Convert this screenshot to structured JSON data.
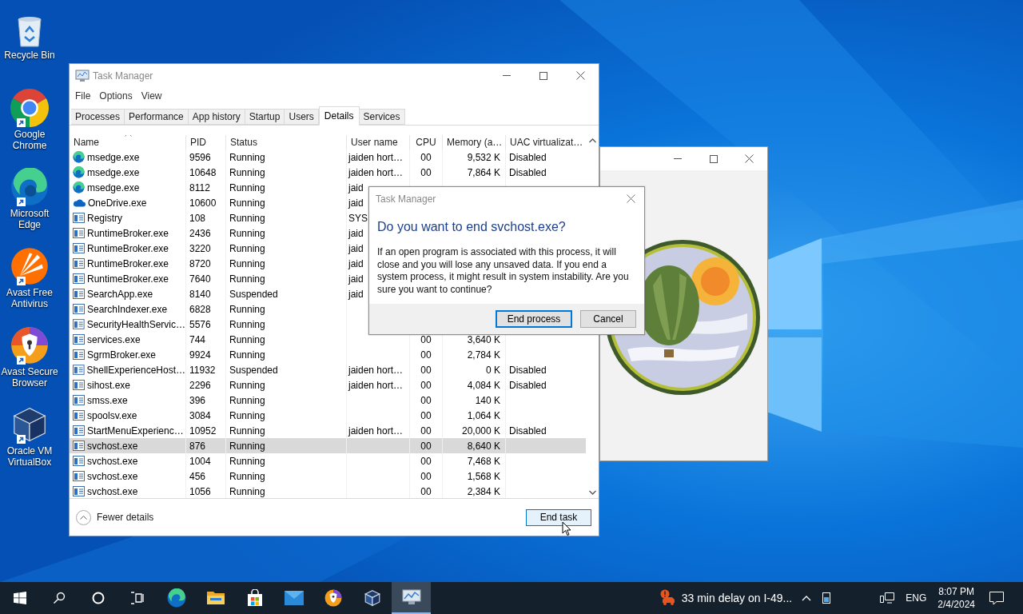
{
  "desktop": {
    "icons": [
      {
        "kind": "bin",
        "label": "Recycle Bin",
        "shortcut": false
      },
      {
        "kind": "chrome",
        "label": "Google Chrome",
        "shortcut": true
      },
      {
        "kind": "edge",
        "label": "Microsoft Edge",
        "shortcut": true
      },
      {
        "kind": "avast",
        "label": "Avast Free Antivirus",
        "shortcut": true
      },
      {
        "kind": "browser",
        "label": "Avast Secure Browser",
        "shortcut": true
      },
      {
        "kind": "virtualbox",
        "label": "Oracle VM VirtualBox",
        "shortcut": true
      }
    ]
  },
  "task_manager": {
    "title": "Task Manager",
    "menu": [
      "File",
      "Options",
      "View"
    ],
    "tabs": [
      {
        "label": "Processes",
        "selected": false
      },
      {
        "label": "Performance",
        "selected": false
      },
      {
        "label": "App history",
        "selected": false
      },
      {
        "label": "Startup",
        "selected": false
      },
      {
        "label": "Users",
        "selected": false
      },
      {
        "label": "Details",
        "selected": true
      },
      {
        "label": "Services",
        "selected": false
      }
    ],
    "columns": [
      {
        "label": "Name",
        "sorted": true
      },
      {
        "label": "PID",
        "sorted": false
      },
      {
        "label": "Status",
        "sorted": false
      },
      {
        "label": "User name",
        "sorted": false
      },
      {
        "label": "CPU",
        "sorted": false
      },
      {
        "label": "Memory (a…",
        "sorted": false
      },
      {
        "label": "UAC virtualizat…",
        "sorted": false
      }
    ],
    "rows": [
      {
        "kind": "edge",
        "name": "msedge.exe",
        "pid": "9596",
        "status": "Running",
        "user": "jaiden hort…",
        "cpu": "00",
        "memory": "9,532 K",
        "uac": "Disabled",
        "selected": false
      },
      {
        "kind": "edge",
        "name": "msedge.exe",
        "pid": "10648",
        "status": "Running",
        "user": "jaiden hort…",
        "cpu": "00",
        "memory": "7,864 K",
        "uac": "Disabled",
        "selected": false
      },
      {
        "kind": "edge",
        "name": "msedge.exe",
        "pid": "8112",
        "status": "Running",
        "user": "jaid",
        "selected": false
      },
      {
        "kind": "onedrive",
        "name": "OneDrive.exe",
        "pid": "10600",
        "status": "Running",
        "user": "jaid",
        "selected": false
      },
      {
        "kind": "app",
        "name": "Registry",
        "pid": "108",
        "status": "Running",
        "user": "SYS",
        "selected": false
      },
      {
        "kind": "app",
        "name": "RuntimeBroker.exe",
        "pid": "2436",
        "status": "Running",
        "user": "jaid",
        "selected": false
      },
      {
        "kind": "app",
        "name": "RuntimeBroker.exe",
        "pid": "3220",
        "status": "Running",
        "user": "jaid",
        "selected": false
      },
      {
        "kind": "app",
        "name": "RuntimeBroker.exe",
        "pid": "8720",
        "status": "Running",
        "user": "jaid",
        "selected": false
      },
      {
        "kind": "app",
        "name": "RuntimeBroker.exe",
        "pid": "7640",
        "status": "Running",
        "user": "jaid",
        "selected": false
      },
      {
        "kind": "app",
        "name": "SearchApp.exe",
        "pid": "8140",
        "status": "Suspended",
        "user": "jaid",
        "selected": false
      },
      {
        "kind": "app",
        "name": "SearchIndexer.exe",
        "pid": "6828",
        "status": "Running",
        "selected": false
      },
      {
        "kind": "app",
        "name": "SecurityHealthServic…",
        "pid": "5576",
        "status": "Running",
        "selected": false
      },
      {
        "kind": "app",
        "name": "services.exe",
        "pid": "744",
        "status": "Running",
        "cpu": "00",
        "memory": "3,640 K",
        "selected": false
      },
      {
        "kind": "app",
        "name": "SgrmBroker.exe",
        "pid": "9924",
        "status": "Running",
        "cpu": "00",
        "memory": "2,784 K",
        "selected": false
      },
      {
        "kind": "app",
        "name": "ShellExperienceHost…",
        "pid": "11932",
        "status": "Suspended",
        "user": "jaiden hort…",
        "cpu": "00",
        "memory": "0 K",
        "uac": "Disabled",
        "selected": false
      },
      {
        "kind": "app",
        "name": "sihost.exe",
        "pid": "2296",
        "status": "Running",
        "user": "jaiden hort…",
        "cpu": "00",
        "memory": "4,084 K",
        "uac": "Disabled",
        "selected": false
      },
      {
        "kind": "app",
        "name": "smss.exe",
        "pid": "396",
        "status": "Running",
        "cpu": "00",
        "memory": "140 K",
        "selected": false
      },
      {
        "kind": "app",
        "name": "spoolsv.exe",
        "pid": "3084",
        "status": "Running",
        "cpu": "00",
        "memory": "1,064 K",
        "selected": false
      },
      {
        "kind": "app",
        "name": "StartMenuExperienc…",
        "pid": "10952",
        "status": "Running",
        "user": "jaiden hort…",
        "cpu": "00",
        "memory": "20,000 K",
        "uac": "Disabled",
        "selected": false
      },
      {
        "kind": "app",
        "name": "svchost.exe",
        "pid": "876",
        "status": "Running",
        "cpu": "00",
        "memory": "8,640 K",
        "selected": true
      },
      {
        "kind": "app",
        "name": "svchost.exe",
        "pid": "1004",
        "status": "Running",
        "cpu": "00",
        "memory": "7,468 K",
        "selected": false
      },
      {
        "kind": "app",
        "name": "svchost.exe",
        "pid": "456",
        "status": "Running",
        "cpu": "00",
        "memory": "1,568 K",
        "selected": false
      },
      {
        "kind": "app",
        "name": "svchost.exe",
        "pid": "1056",
        "status": "Running",
        "cpu": "00",
        "memory": "2,384 K",
        "selected": false
      }
    ],
    "fewer_details": "Fewer details",
    "end_task": "End task"
  },
  "dialog": {
    "title": "Task Manager",
    "heading": "Do you want to end svchost.exe?",
    "message": "If an open program is associated with this process, it will close and you will lose any unsaved data. If you end a system process, it might result in system instability. Are you sure you want to continue?",
    "buttons": [
      {
        "label": "End process",
        "default": true
      },
      {
        "label": "Cancel",
        "default": false
      }
    ]
  },
  "taskbar": {
    "items": [
      {
        "kind": "start",
        "active": false
      },
      {
        "kind": "search",
        "active": false
      },
      {
        "kind": "cortana",
        "active": false
      },
      {
        "kind": "taskview",
        "active": false
      },
      {
        "kind": "edge",
        "active": false
      },
      {
        "kind": "explorer",
        "active": false
      },
      {
        "kind": "store",
        "active": false
      },
      {
        "kind": "mail",
        "active": false
      },
      {
        "kind": "browser",
        "active": false
      },
      {
        "kind": "virtualbox",
        "active": false
      },
      {
        "kind": "taskmanager",
        "active": true
      }
    ],
    "news": "33 min delay on I-49...",
    "language": "ENG",
    "time": "8:07 PM",
    "date": "2/4/2024"
  }
}
